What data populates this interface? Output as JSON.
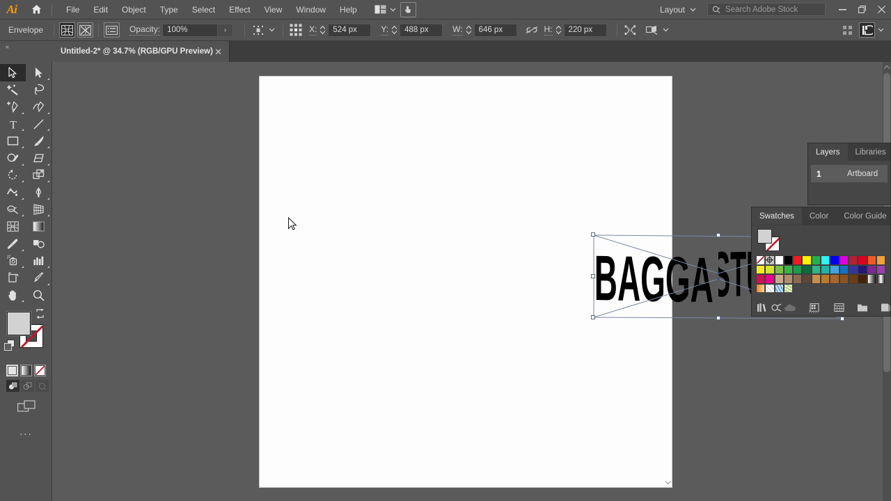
{
  "app": {
    "name": "Adobe Illustrator",
    "logo_text": "Ai",
    "home_icon": "home-icon"
  },
  "menubar": {
    "items": [
      "File",
      "Edit",
      "Object",
      "Type",
      "Select",
      "Effect",
      "View",
      "Window",
      "Help"
    ],
    "arrange_icon": "arrange-documents-icon",
    "arrange_chevron": "chevron-down-icon",
    "touch_icon": "touch-workspace-icon",
    "layout_label": "Layout",
    "layout_chevron": "chevron-down-icon",
    "search": {
      "placeholder": "Search Adobe Stock",
      "icon": "search-icon"
    },
    "window_controls": {
      "minimize": "minimize-icon",
      "maximize": "maximize-icon",
      "close": "close-icon"
    }
  },
  "controlbar": {
    "object_type": "Envelope",
    "envelope_mesh_icon": "envelope-mesh-icon",
    "envelope_warp_icon": "envelope-warp-icon",
    "envelope_options_icon": "envelope-options-icon",
    "opacity_label": "Opacity:",
    "opacity_value": "100%",
    "opacity_more_icon": "chevron-right-icon",
    "align_icon": "align-icon",
    "align_chevron": "chevron-down-icon",
    "reference_point_icon": "reference-point-icon",
    "x_label": "X:",
    "x_value": "524 px",
    "y_label": "Y:",
    "y_value": "488 px",
    "w_label": "W:",
    "w_value": "646 px",
    "h_label": "H:",
    "h_value": "220 px",
    "link_icon": "unlink-proportions-icon",
    "transform_icon": "transform-icon",
    "shape_icon": "shape-builder-icon",
    "shape_chevron": "chevron-down-icon",
    "more_options_icon": "more-options-icon",
    "properties_icon": "properties-panel-icon",
    "properties_chevron": "chevron-down-icon"
  },
  "document_tab": {
    "title": "Untitled-2* @ 34.7% (RGB/GPU Preview)",
    "close_icon": "close-icon",
    "collapse_icon": "collapse-panel-icon"
  },
  "toolbar": {
    "tools": [
      {
        "name": "selection-tool",
        "glyph": "selection",
        "selected": true,
        "has_flyout": false
      },
      {
        "name": "direct-selection-tool",
        "glyph": "direct-selection",
        "selected": false,
        "has_flyout": true
      },
      {
        "name": "magic-wand-tool",
        "glyph": "magic-wand",
        "selected": false,
        "has_flyout": false
      },
      {
        "name": "lasso-tool",
        "glyph": "lasso",
        "selected": false,
        "has_flyout": false
      },
      {
        "name": "pen-tool",
        "glyph": "pen",
        "selected": false,
        "has_flyout": true
      },
      {
        "name": "curvature-tool",
        "glyph": "curvature",
        "selected": false,
        "has_flyout": false
      },
      {
        "name": "type-tool",
        "glyph": "type",
        "selected": false,
        "has_flyout": true
      },
      {
        "name": "line-segment-tool",
        "glyph": "line",
        "selected": false,
        "has_flyout": true
      },
      {
        "name": "rectangle-tool",
        "glyph": "rectangle",
        "selected": false,
        "has_flyout": true
      },
      {
        "name": "paintbrush-tool",
        "glyph": "paintbrush",
        "selected": false,
        "has_flyout": true
      },
      {
        "name": "shaper-tool",
        "glyph": "shaper",
        "selected": false,
        "has_flyout": true
      },
      {
        "name": "eraser-tool",
        "glyph": "eraser",
        "selected": false,
        "has_flyout": true
      },
      {
        "name": "rotate-tool",
        "glyph": "rotate",
        "selected": false,
        "has_flyout": true
      },
      {
        "name": "scale-tool",
        "glyph": "scale",
        "selected": false,
        "has_flyout": true
      },
      {
        "name": "width-tool",
        "glyph": "width",
        "selected": false,
        "has_flyout": true
      },
      {
        "name": "free-transform-tool",
        "glyph": "free-transform",
        "selected": false,
        "has_flyout": true
      },
      {
        "name": "shape-builder-tool",
        "glyph": "shape-builder",
        "selected": false,
        "has_flyout": true
      },
      {
        "name": "perspective-grid-tool",
        "glyph": "perspective-grid",
        "selected": false,
        "has_flyout": true
      },
      {
        "name": "mesh-tool",
        "glyph": "mesh",
        "selected": false,
        "has_flyout": false
      },
      {
        "name": "gradient-tool",
        "glyph": "gradient",
        "selected": false,
        "has_flyout": false
      },
      {
        "name": "eyedropper-tool",
        "glyph": "eyedropper",
        "selected": false,
        "has_flyout": true
      },
      {
        "name": "blend-tool",
        "glyph": "blend",
        "selected": false,
        "has_flyout": false
      },
      {
        "name": "symbol-sprayer-tool",
        "glyph": "symbol-sprayer",
        "selected": false,
        "has_flyout": true
      },
      {
        "name": "column-graph-tool",
        "glyph": "column-graph",
        "selected": false,
        "has_flyout": true
      },
      {
        "name": "artboard-tool",
        "glyph": "artboard",
        "selected": false,
        "has_flyout": false
      },
      {
        "name": "slice-tool",
        "glyph": "slice",
        "selected": false,
        "has_flyout": true
      },
      {
        "name": "hand-tool",
        "glyph": "hand",
        "selected": false,
        "has_flyout": true
      },
      {
        "name": "zoom-tool",
        "glyph": "zoom",
        "selected": false,
        "has_flyout": false
      }
    ],
    "fill_color": "#d2d2d2",
    "stroke_color": "#ffffff",
    "swap_icon": "swap-fill-stroke-icon",
    "default_icon": "default-fill-stroke-icon",
    "color_modes": [
      {
        "name": "color-mode-button",
        "type": "flat",
        "active": true
      },
      {
        "name": "gradient-mode-button",
        "type": "gradient",
        "active": false
      },
      {
        "name": "none-mode-button",
        "type": "none",
        "active": false
      }
    ],
    "draw_modes": [
      {
        "name": "draw-normal-button",
        "active": true
      },
      {
        "name": "draw-behind-button",
        "active": false
      },
      {
        "name": "draw-inside-button",
        "active": false
      }
    ],
    "screen_mode_icon": "change-screen-mode-icon",
    "edit_toolbar_icon": "edit-toolbar-icon",
    "more_label": "..."
  },
  "canvas": {
    "artwork_text": "BAGGA STUDIOS",
    "artwork_fill": "#000000",
    "selection_color": "#6878a0",
    "artboard_color": "#fdfdfd",
    "background_color": "#5b5b5b",
    "cursor_icon": "arrow-cursor",
    "scroll_up_icon": "scroll-up-icon",
    "scroll_down_icon": "scroll-down-icon"
  },
  "layers_panel": {
    "tabs": [
      {
        "label": "Layers",
        "active": true
      },
      {
        "label": "Libraries",
        "active": false
      }
    ],
    "rows": [
      {
        "number": "1",
        "name": "Artboard"
      }
    ]
  },
  "swatches_panel": {
    "tabs": [
      {
        "label": "Swatches",
        "active": true
      },
      {
        "label": "Color",
        "active": false
      },
      {
        "label": "Color Guide",
        "active": false
      }
    ],
    "current_fill": "#d2d2d2",
    "current_stroke": "#ffffff",
    "grid": [
      [
        "none",
        "registration",
        "#ffffff",
        "#000000",
        "#ed1c24",
        "#fff200",
        "#00a651",
        "#00aeef",
        "#2e3192",
        "#ec008c",
        "#c1272d",
        "#ed1c24",
        "#f26522",
        "#fbb040"
      ],
      [
        "#fff200",
        "#d7df23",
        "#8dc63f",
        "#39b54a",
        "#009245",
        "#006837",
        "#00a99d",
        "#00a99d",
        "#29abe2",
        "#0071bc",
        "#2e3192",
        "#1b1464",
        "#92278f",
        "#c7b299"
      ],
      [
        "#ed145b",
        "#ec008c",
        "#c7b299",
        "#c69c6d",
        "#a67c52",
        "#754c24",
        "#c69c6d",
        "#b5873f",
        "#a0522d",
        "#8c6239",
        "#754c24",
        "#42210b",
        "gradient-bw",
        "gradient-bw2"
      ],
      [
        "gradient-orange",
        "pattern-dots",
        "pattern-blue",
        "pattern-green"
      ]
    ],
    "footer_icons": [
      "swatch-libraries-icon",
      "show-swatch-kinds-icon",
      "add-to-library-icon",
      "swatch-options-icon",
      "new-color-group-icon",
      "new-swatch-icon",
      "delete-swatch-icon"
    ]
  }
}
